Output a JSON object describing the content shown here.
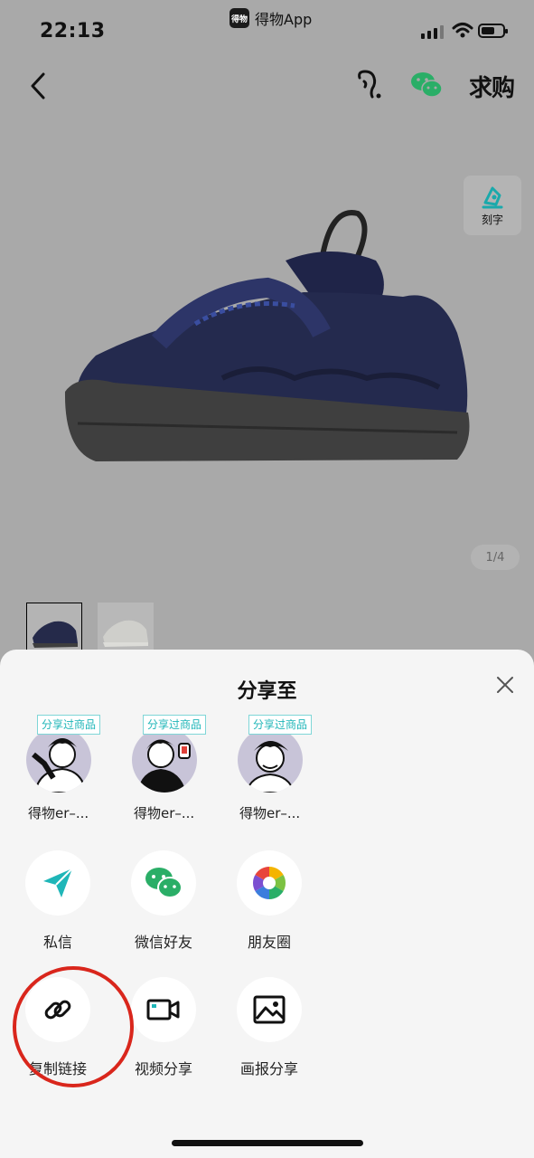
{
  "status_bar": {
    "time": "22:13",
    "app_name": "得物App",
    "app_logo_text": "得物"
  },
  "nav": {
    "seek_label": "求购"
  },
  "engrave": {
    "label": "刻字"
  },
  "gallery": {
    "page_indicator": "1/4"
  },
  "share_sheet": {
    "title": "分享至",
    "recent_contacts": [
      {
        "badge": "分享过商品",
        "name": "得物er–..."
      },
      {
        "badge": "分享过商品",
        "name": "得物er–..."
      },
      {
        "badge": "分享过商品",
        "name": "得物er–..."
      }
    ],
    "actions_row1": [
      {
        "label": "私信",
        "icon": "paper-plane-icon"
      },
      {
        "label": "微信好友",
        "icon": "wechat-icon"
      },
      {
        "label": "朋友圈",
        "icon": "moments-icon"
      }
    ],
    "actions_row2": [
      {
        "label": "复制链接",
        "icon": "link-icon"
      },
      {
        "label": "视频分享",
        "icon": "video-camera-icon"
      },
      {
        "label": "画报分享",
        "icon": "image-icon"
      }
    ]
  },
  "colors": {
    "accent_teal": "#1fb6b8",
    "wechat_green": "#2aae67",
    "highlight_red": "#d9261c"
  }
}
